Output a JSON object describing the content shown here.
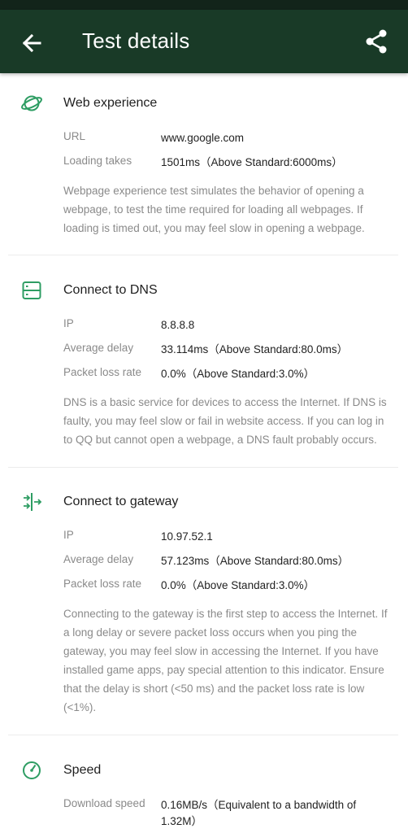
{
  "header": {
    "title": "Test details",
    "bar_color": "#193a27",
    "status_color": "#12241a",
    "icons": {
      "back": "arrow-left-icon",
      "share": "share-icon"
    }
  },
  "accent_color": "#2e9d63",
  "sections": {
    "web": {
      "icon": "planet-icon",
      "title": "Web experience",
      "rows": [
        {
          "label": "URL",
          "value": "www.google.com"
        },
        {
          "label": "Loading takes",
          "value": "1501ms（Above Standard:6000ms）"
        }
      ],
      "description": "Webpage experience test simulates the behavior of opening a webpage, to test the time required for loading all webpages. If loading is timed out, you may feel slow in opening a webpage."
    },
    "dns": {
      "icon": "server-icon",
      "title": "Connect to DNS",
      "rows": [
        {
          "label": "IP",
          "value": "8.8.8.8"
        },
        {
          "label": "Average delay",
          "value": "33.114ms（Above Standard:80.0ms）"
        },
        {
          "label": "Packet loss rate",
          "value": "0.0%（Above Standard:3.0%）"
        }
      ],
      "description": "DNS is a basic service for devices to access the Internet. If DNS is faulty, you may feel slow or fail in website access. If you can log in to QQ but cannot open a webpage, a DNS fault probably occurs."
    },
    "gateway": {
      "icon": "gateway-arrows-icon",
      "title": "Connect to gateway",
      "rows": [
        {
          "label": "IP",
          "value": "10.97.52.1"
        },
        {
          "label": "Average delay",
          "value": "57.123ms（Above Standard:80.0ms）"
        },
        {
          "label": "Packet loss rate",
          "value": "0.0%（Above Standard:3.0%）"
        }
      ],
      "description": "Connecting to the gateway is the first step to access the Internet. If a long delay or severe packet loss occurs when you ping the gateway, you may feel slow in accessing the Internet. If you have installed game apps, pay special attention to this indicator. Ensure that the delay is short (<50 ms) and the packet loss rate is low (<1%)."
    },
    "speed": {
      "icon": "speedometer-icon",
      "title": "Speed",
      "rows": [
        {
          "label": "Download speed",
          "value": "0.16MB/s（Equivalent to a bandwidth of 1.32M）"
        }
      ]
    }
  }
}
